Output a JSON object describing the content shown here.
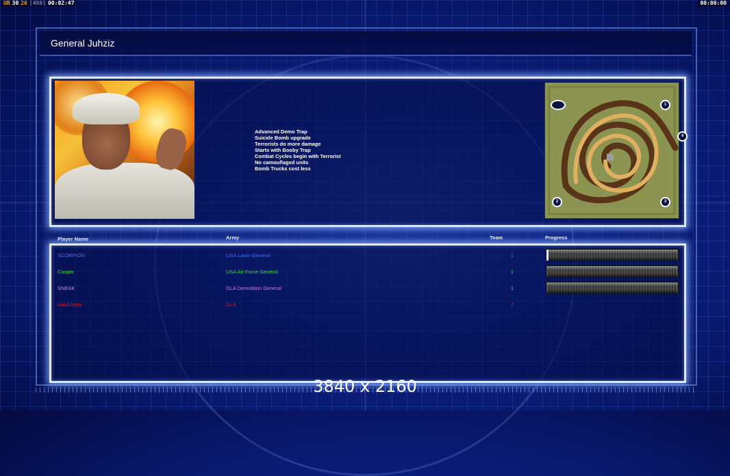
{
  "hud": {
    "left": [
      {
        "text": "UR",
        "color": "#f0a020"
      },
      {
        "text": "30",
        "color": "#ffffff"
      },
      {
        "text": "26",
        "color": "#f0a020"
      },
      {
        "text": "[480]",
        "color": "#6a80c0"
      },
      {
        "text": "00:02:47",
        "color": "#ffffff"
      }
    ],
    "right_timer": "00:00:00"
  },
  "general": {
    "title": "General Juhziz",
    "features": [
      "Advanced Demo Trap",
      "Suicide Bomb upgrade",
      "Terrorists do more damage",
      "Starts with Booby Trap",
      "Combat Cycles begin with Terrorist",
      "No camouflaged units",
      "Bomb Trucks cost less"
    ]
  },
  "minimap": {
    "start_positions": [
      "1",
      "2",
      "3",
      "4"
    ]
  },
  "table": {
    "headers": {
      "player": "Player Name",
      "army": "Army",
      "team": "Team",
      "progress": "Progress"
    },
    "rows": [
      {
        "name": "SCORPION",
        "army": "USA Laser General",
        "team": "1",
        "color": "#3b6cff",
        "progress": 0.01
      },
      {
        "name": "Casper",
        "army": "USA Air Force General",
        "team": "1",
        "color": "#33dd33",
        "progress": 0
      },
      {
        "name": "SNEAK",
        "army": "GLA Demolition General",
        "team": "1",
        "color": "#e070e0",
        "progress": 0
      },
      {
        "name": "Hard Army",
        "army": "GLA",
        "team": "2",
        "color": "#e01818",
        "progress": null
      }
    ]
  },
  "overlay": {
    "resolution": "3840 x 2160"
  }
}
